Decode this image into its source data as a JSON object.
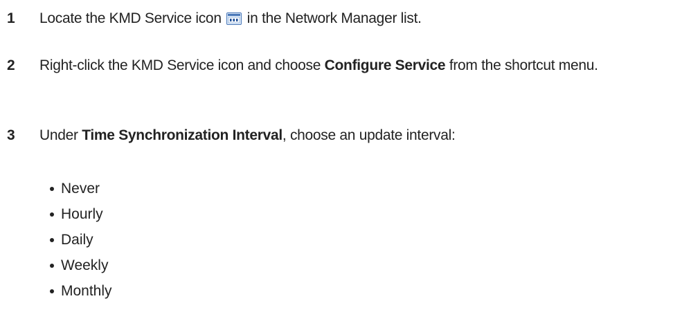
{
  "steps": [
    {
      "number": "1",
      "text_before": "Locate the KMD Service icon",
      "icon": "kmd-service-icon",
      "text_after": "in the Network Manager list."
    },
    {
      "number": "2",
      "text_before": "Right-click the KMD Service icon and choose ",
      "bold": "Configure Service",
      "text_after": " from the shortcut menu."
    },
    {
      "number": "3",
      "text_before": "Under ",
      "bold": "Time Synchronization Interval",
      "text_after": ", choose an update interval:"
    }
  ],
  "intervals": [
    "Never",
    "Hourly",
    "Daily",
    "Weekly",
    "Monthly"
  ],
  "icon_colors": {
    "frame": "#4a78b8",
    "fill": "#dbe8f7",
    "label": "#1f4f96"
  }
}
